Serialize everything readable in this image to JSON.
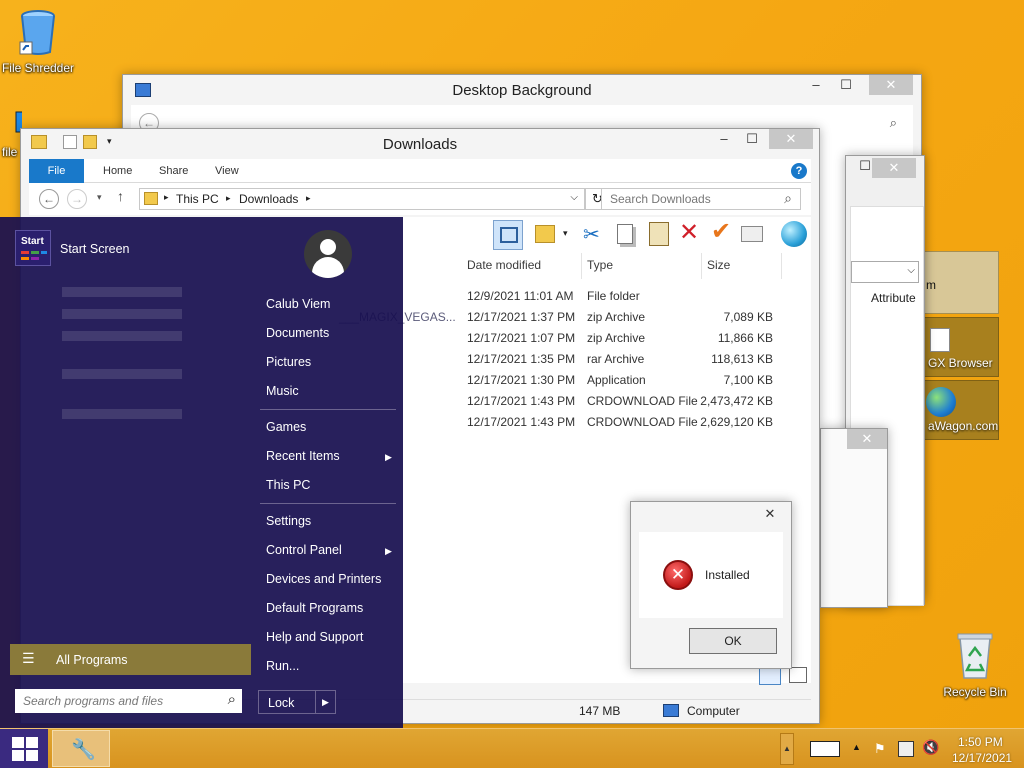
{
  "desktop": {
    "icons": [
      {
        "label": "File Shredder"
      },
      {
        "label": "file"
      },
      {
        "label": "Recycle Bin"
      },
      {
        "label": "GX Browser"
      },
      {
        "label": "aWagon.com"
      }
    ],
    "bg_color": "#f5a713"
  },
  "bg_window": {
    "title": "Desktop Background",
    "attribute_header": "Attribute",
    "partial_label": "m"
  },
  "downloads": {
    "title": "Downloads",
    "tabs": [
      "File",
      "Home",
      "Share",
      "View"
    ],
    "breadcrumb": [
      "This PC",
      "Downloads"
    ],
    "search_placeholder": "Search Downloads",
    "columns": [
      "Date modified",
      "Type",
      "Size"
    ],
    "rows": [
      {
        "name": "",
        "date": "12/9/2021 11:01 AM",
        "type": "File folder",
        "size": ""
      },
      {
        "name": "___MAGIX_VEGAS...",
        "date": "12/17/2021 1:37 PM",
        "type": "zip Archive",
        "size": "7,089 KB"
      },
      {
        "name": "",
        "date": "12/17/2021 1:07 PM",
        "type": "zip Archive",
        "size": "11,866 KB"
      },
      {
        "name": "",
        "date": "12/17/2021 1:35 PM",
        "type": "rar Archive",
        "size": "118,613 KB"
      },
      {
        "name": "",
        "date": "12/17/2021 1:30 PM",
        "type": "Application",
        "size": "7,100 KB"
      },
      {
        "name": "",
        "date": "12/17/2021 1:43 PM",
        "type": "CRDOWNLOAD File",
        "size": "2,473,472 KB"
      },
      {
        "name": "",
        "date": "12/17/2021 1:43 PM",
        "type": "CRDOWNLOAD File",
        "size": "2,629,120 KB"
      }
    ],
    "status_size": "147 MB",
    "status_location": "Computer",
    "accent": "#1979ca"
  },
  "dialog": {
    "message": "Installed",
    "ok_label": "OK"
  },
  "start_menu": {
    "tile_label": "Start",
    "start_screen": "Start Screen",
    "user_name": "Calub Viem",
    "right_items": [
      "Documents",
      "Pictures",
      "Music",
      "Games",
      "Recent Items",
      "This PC",
      "Settings",
      "Control Panel",
      "Devices and Printers",
      "Default Programs",
      "Help and Support",
      "Run..."
    ],
    "all_programs": "All Programs",
    "search_placeholder": "Search programs and files",
    "lock_label": "Lock",
    "bg_color": "#180f50",
    "highlight_color": "#8a7a3a"
  },
  "taskbar": {
    "time": "1:50 PM",
    "date": "12/17/2021"
  }
}
